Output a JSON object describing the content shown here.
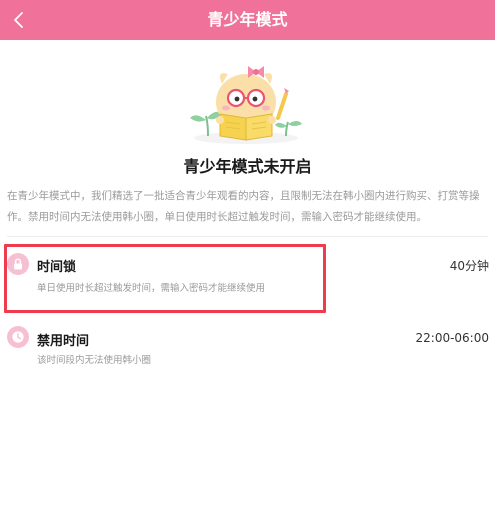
{
  "header": {
    "title": "青少年模式",
    "back_icon": "chevron-left-icon",
    "bg_color": "#f0719a"
  },
  "hero": {
    "mascot_icon": "reading-mascot-illustration",
    "status_title": "青少年模式未开启",
    "description": "在青少年模式中，我们精选了一批适合青少年观看的内容，且限制无法在韩小圈内进行购买、打赏等操作。禁用时间内无法使用韩小圈，单日使用时长超过触发时间，需输入密码才能继续使用。"
  },
  "settings": [
    {
      "icon": "lock-icon",
      "title": "时间锁",
      "value": "40分钟",
      "subtitle": "单日使用时长超过触发时间，需输入密码才能继续使用"
    },
    {
      "icon": "clock-icon",
      "title": "禁用时间",
      "value": "22:00-06:00",
      "subtitle": "该时间段内无法使用韩小圈"
    }
  ],
  "colors": {
    "accent": "#f0719a",
    "icon_bg": "#f7bfd2",
    "highlight": "#ee3b4e"
  }
}
